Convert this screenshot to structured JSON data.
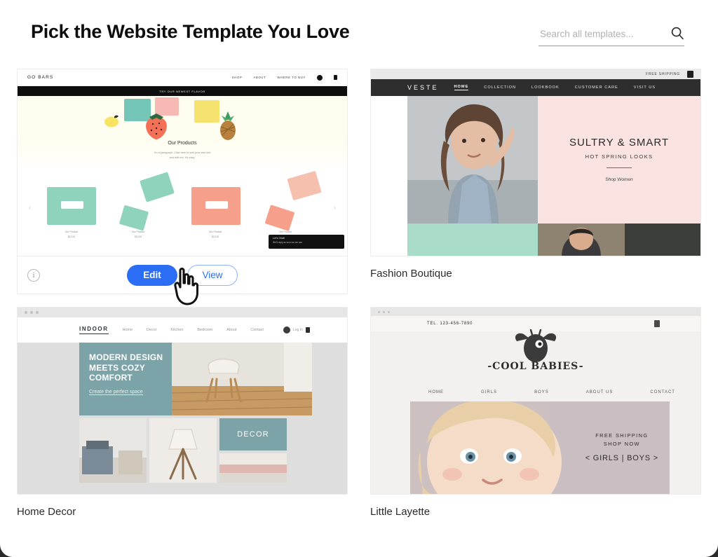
{
  "header": {
    "title": "Pick the Website Template You Love",
    "search": {
      "placeholder": "Search all templates...",
      "value": "",
      "icon": "search-icon"
    }
  },
  "colors": {
    "accent_blue": "#2b6ef5",
    "teal": "#7ca3a8",
    "mint": "#a9dcc9",
    "blush": "#fae3e1",
    "page_background": "#ffffff"
  },
  "actions": {
    "edit_label": "Edit",
    "view_label": "View",
    "info_icon": "info-icon",
    "cursor_icon": "hand-cursor-icon"
  },
  "templates": [
    {
      "name": "",
      "preview": {
        "brand": "GO BARS",
        "nav": [
          "SHOP",
          "ABOUT",
          "WHERE TO BUY"
        ],
        "announcement": "TRY OUR NEWEST FLAVOR",
        "hero_title": "Our Products",
        "hero_sub_line1": "I'm a paragraph. Click here to add your own text",
        "hero_sub_line2": "and edit me. It's easy.",
        "products": [
          {
            "title": "Our Product",
            "price": "$12.00"
          },
          {
            "title": "Our Product",
            "price": "$12.00"
          },
          {
            "title": "Our Product",
            "price": "$12.00"
          },
          {
            "title": "Our Product",
            "price": "$12.00"
          }
        ],
        "chat_title": "Let's Chat!",
        "chat_status": "We'll reply as soon as we can",
        "prev_arrow": "‹",
        "next_arrow": "›"
      }
    },
    {
      "name": "Fashion Boutique",
      "preview": {
        "top_bar": "FREE SHIPPING",
        "logo": "VESTE",
        "nav": [
          "HOME",
          "COLLECTION",
          "LOOKBOOK",
          "CUSTOMER CARE",
          "VISIT US"
        ],
        "active_nav": "HOME",
        "headline": "SULTRY & SMART",
        "subhead": "HOT SPRING LOOKS",
        "cta": "Shop Women"
      }
    },
    {
      "name": "Home Decor",
      "preview": {
        "logo": "INDOOR",
        "nav": [
          "Home",
          "Decor",
          "Kitchen",
          "Bedroom",
          "About",
          "Contact"
        ],
        "account": "Log In",
        "headline": "MODERN DESIGN MEETS COZY COMFORT",
        "cta": "Create the perfect space",
        "tile_label": "DECOR"
      }
    },
    {
      "name": "Little Layette",
      "preview": {
        "phone": "TEL. 123-456-7890",
        "brand": "-COOL BABIES-",
        "nav": [
          "HOME",
          "GIRLS",
          "BOYS",
          "ABOUT US",
          "CONTACT"
        ],
        "promo_line1": "FREE SHIPPING",
        "promo_line2": "SHOP NOW",
        "promo_line3": "< GIRLS  |  BOYS >"
      }
    }
  ]
}
